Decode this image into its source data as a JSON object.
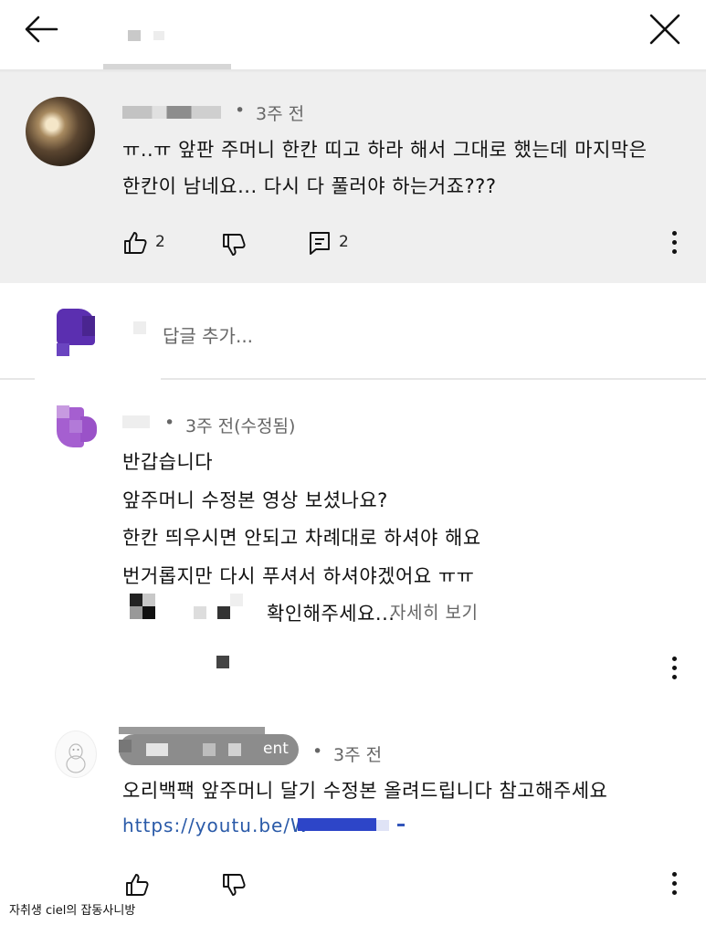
{
  "top_comment": {
    "time": "3주 전",
    "text_line1": "ㅠ..ㅠ 앞판 주머니 한칸 띠고 하라 해서 그대로 했는데 마지막은",
    "text_line2": "한칸이 남네요... 다시 다 풀러야 하는거죠???",
    "like_count": "2",
    "reply_count": "2"
  },
  "reply_box": {
    "placeholder": "답글 추가..."
  },
  "reply1": {
    "time": "3주 전(수정됨)",
    "lines": [
      "반갑습니다",
      "앞주머니 수정본 영상 보셨나요?",
      "한칸 띄우시면 안되고 차례대로 하셔야 해요",
      "번거롭지만 다시 푸셔서 하셔야겠어요 ㅠㅠ"
    ],
    "trailing_text": "확인해주세요...",
    "more_label": "자세히 보기"
  },
  "reply2": {
    "badge_suffix": "ent",
    "time": "3주 전",
    "text": "오리백팩 앞주머니 달기 수정본 올려드립니다 참고해주세요",
    "link": "https://youtu.be/W"
  },
  "watermark": "자취생 ciel의 잡동사니방",
  "colors": {
    "top_bg": "#efefef",
    "link": "#2a5aa8",
    "avatar_purple": "#5b2fb0"
  },
  "icons": [
    "back-arrow-icon",
    "close-icon",
    "thumbs-up-icon",
    "thumbs-down-icon",
    "reply-icon",
    "more-vert-icon"
  ]
}
